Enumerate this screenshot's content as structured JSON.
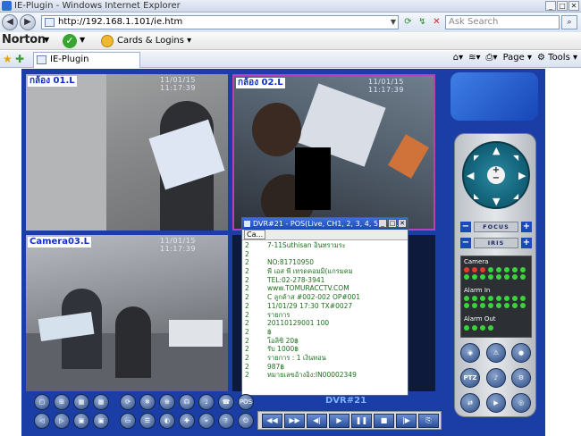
{
  "browser": {
    "window_title": "IE-Plugin - Windows Internet Explorer",
    "url": "http://192.168.1.101/ie.htm",
    "search_placeholder": "Ask Search",
    "norton_label": "Norton",
    "cards_logins_label": "Cards & Logins",
    "tab_title": "IE-Plugin",
    "page_menu": "Page",
    "tools_menu": "Tools"
  },
  "cameras": [
    {
      "label": "กล้อง 01.L",
      "timestamp": "11/01/15 11:17:39"
    },
    {
      "label": "กล้อง 02.L",
      "timestamp": "11/01/15 11:17:39"
    },
    {
      "label": "Camera03.L",
      "timestamp": "11/01/15 11:17:39"
    }
  ],
  "pos_window": {
    "title": "DVR#21 - POS(Live, CH1, 2, 3, 4, 5, 6, ...",
    "toolbar_button": "Ca...",
    "lines": [
      {
        "n": "2",
        "text": "7-11Suthisan อินทรามระ"
      },
      {
        "n": "2",
        "text": ""
      },
      {
        "n": "2",
        "text": "NO:81710950"
      },
      {
        "n": "2",
        "text": "พี เอส พี เทรดคอมมิ(แกรมคม"
      },
      {
        "n": "2",
        "text": "TEL:02-278-3941"
      },
      {
        "n": "2",
        "text": "www.TOMURACCTV.COM"
      },
      {
        "n": "2",
        "text": "C ลูกค้าส #002-002  OP#001"
      },
      {
        "n": "2",
        "text": "11/01/29 17:30  TX#0027"
      },
      {
        "n": "2",
        "text": "รายการ"
      },
      {
        "n": "2",
        "text": "20110129001          100"
      },
      {
        "n": "2",
        "text": "฿"
      },
      {
        "n": "2",
        "text": "โอลิซิ                20฿"
      },
      {
        "n": "2",
        "text": "รับ              1000฿"
      },
      {
        "n": "2",
        "text": "รายการ : 1     เงินทอน"
      },
      {
        "n": "2",
        "text": "  987฿"
      },
      {
        "n": "2",
        "text": "หมายเลขอ้างอิง:IN00002349"
      }
    ]
  },
  "controls": {
    "focus_label": "FOCUS",
    "iris_label": "IRIS",
    "camera_label": "Camera",
    "alarm_in_label": "Alarm In",
    "alarm_out_label": "Alarm Out",
    "ptz_label": "PTZ",
    "dvr_label": "DVR#21",
    "pos_button": "POS"
  },
  "colors": {
    "player_bg": "#1a3ea5",
    "pos_text": "#1c6f1c",
    "camera_label": "#1030c8",
    "active_cam_border": "#b640c0"
  }
}
